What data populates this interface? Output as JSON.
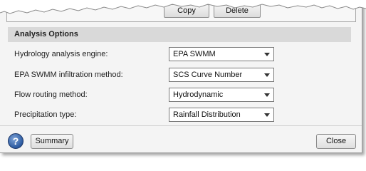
{
  "toolbar": {
    "copy_label": "Copy",
    "delete_label": "Delete"
  },
  "section": {
    "title": "Analysis Options"
  },
  "rows": [
    {
      "label": "Hydrology analysis engine:",
      "value": "EPA SWMM"
    },
    {
      "label": "EPA SWMM infiltration method:",
      "value": "SCS Curve Number"
    },
    {
      "label": "Flow routing method:",
      "value": "Hydrodynamic"
    },
    {
      "label": "Precipitation type:",
      "value": "Rainfall Distribution"
    }
  ],
  "footer": {
    "help_glyph": "?",
    "summary_label": "Summary",
    "close_label": "Close"
  },
  "icons": {
    "help": "help-icon",
    "dropdown": "chevron-down-icon"
  }
}
